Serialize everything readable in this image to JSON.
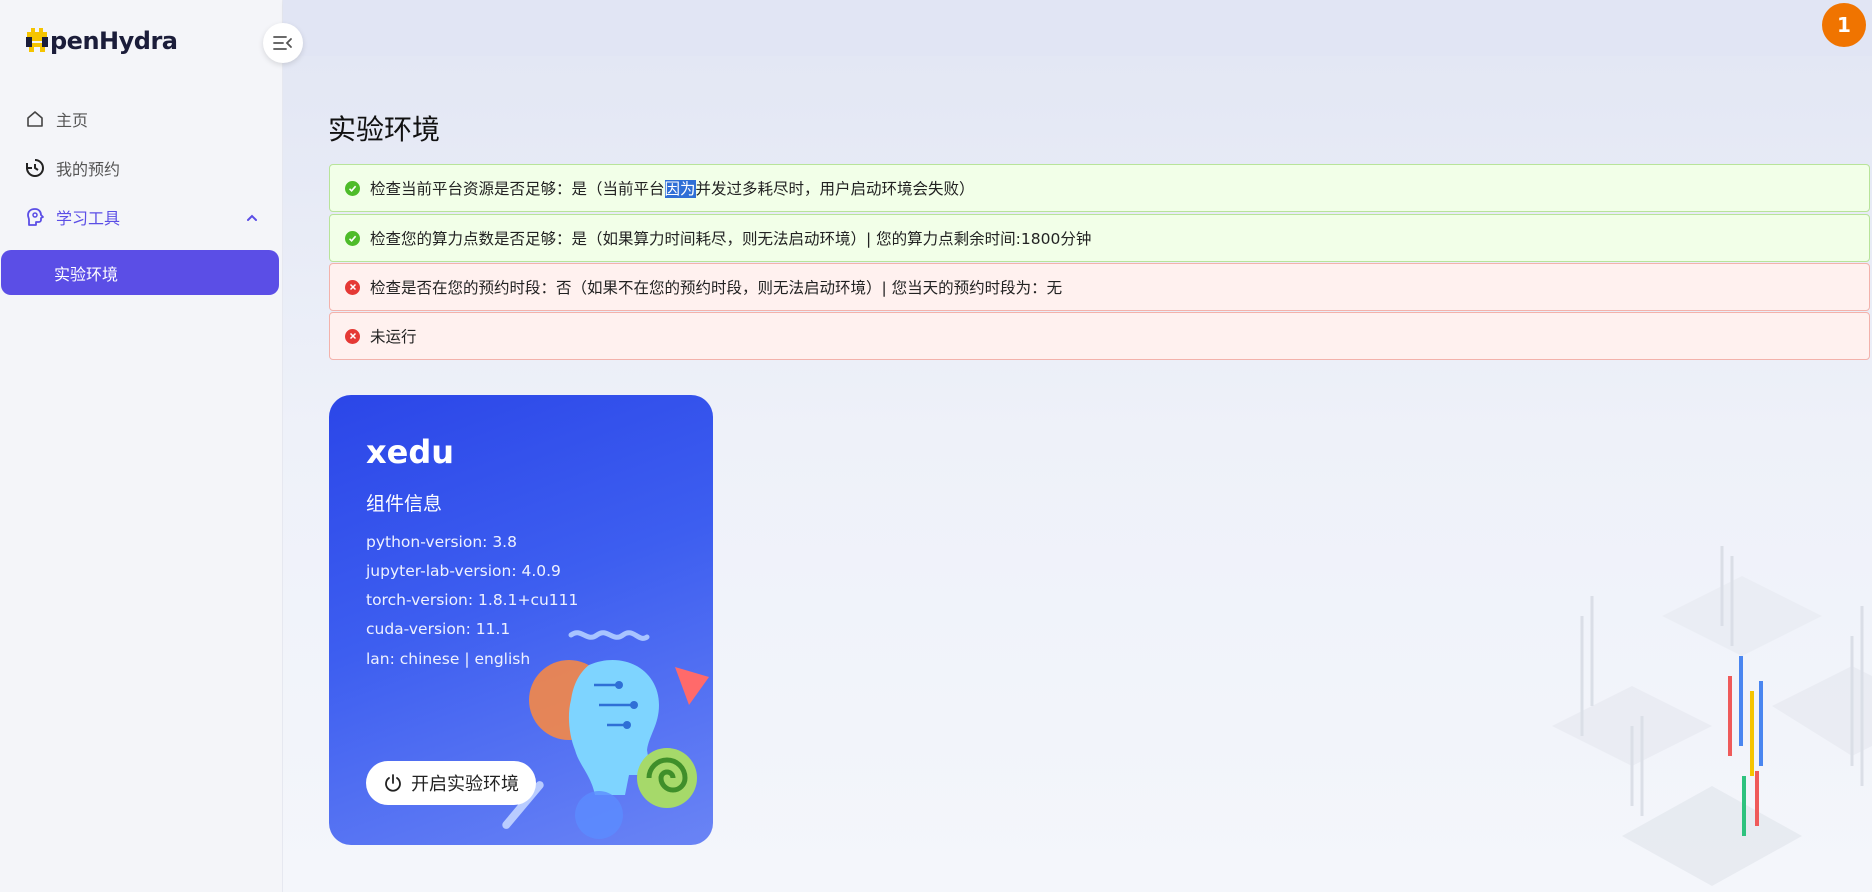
{
  "app": {
    "logo_text": "penHydra",
    "logo_prefix": "O"
  },
  "sidebar": {
    "items": [
      {
        "label": "主页",
        "icon": "home-icon"
      },
      {
        "label": "我的预约",
        "icon": "history-icon"
      },
      {
        "label": "学习工具",
        "icon": "brain-icon"
      }
    ],
    "sub_items": [
      {
        "label": "实验环境"
      }
    ],
    "accent": "#5b4ee6"
  },
  "header": {
    "notification_count": "1",
    "badge_color": "#f07400"
  },
  "main": {
    "title": "实验环境",
    "alerts": [
      {
        "status": "success",
        "pre": "检查当前平台资源是否足够：是（当前平台",
        "highlight": "因为",
        "post": "并发过多耗尽时，用户启动环境会失败）"
      },
      {
        "status": "success",
        "text": "检查您的算力点数是否足够：是（如果算力时间耗尽，则无法启动环境）| 您的算力点剩余时间:1800分钟"
      },
      {
        "status": "error",
        "text": "检查是否在您的预约时段：否（如果不在您的预约时段，则无法启动环境）| 您当天的预约时段为：无"
      },
      {
        "status": "error",
        "text": "未运行"
      }
    ],
    "card": {
      "name": "xedu",
      "section": "组件信息",
      "specs": [
        "python-version: 3.8",
        "jupyter-lab-version: 4.0.9",
        "torch-version: 1.8.1+cu111",
        "cuda-version: 11.1",
        "lan: chinese | english"
      ],
      "start_label": "开启实验环境"
    }
  }
}
